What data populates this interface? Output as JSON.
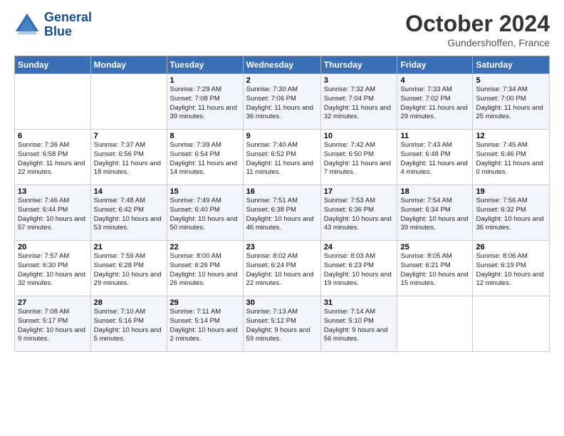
{
  "header": {
    "logo_line1": "General",
    "logo_line2": "Blue",
    "month": "October 2024",
    "location": "Gundershoffen, France"
  },
  "days_of_week": [
    "Sunday",
    "Monday",
    "Tuesday",
    "Wednesday",
    "Thursday",
    "Friday",
    "Saturday"
  ],
  "weeks": [
    [
      {
        "num": "",
        "info": ""
      },
      {
        "num": "",
        "info": ""
      },
      {
        "num": "1",
        "info": "Sunrise: 7:29 AM\nSunset: 7:08 PM\nDaylight: 11 hours and 39 minutes."
      },
      {
        "num": "2",
        "info": "Sunrise: 7:30 AM\nSunset: 7:06 PM\nDaylight: 11 hours and 36 minutes."
      },
      {
        "num": "3",
        "info": "Sunrise: 7:32 AM\nSunset: 7:04 PM\nDaylight: 11 hours and 32 minutes."
      },
      {
        "num": "4",
        "info": "Sunrise: 7:33 AM\nSunset: 7:02 PM\nDaylight: 11 hours and 29 minutes."
      },
      {
        "num": "5",
        "info": "Sunrise: 7:34 AM\nSunset: 7:00 PM\nDaylight: 11 hours and 25 minutes."
      }
    ],
    [
      {
        "num": "6",
        "info": "Sunrise: 7:36 AM\nSunset: 6:58 PM\nDaylight: 11 hours and 22 minutes."
      },
      {
        "num": "7",
        "info": "Sunrise: 7:37 AM\nSunset: 6:56 PM\nDaylight: 11 hours and 18 minutes."
      },
      {
        "num": "8",
        "info": "Sunrise: 7:39 AM\nSunset: 6:54 PM\nDaylight: 11 hours and 14 minutes."
      },
      {
        "num": "9",
        "info": "Sunrise: 7:40 AM\nSunset: 6:52 PM\nDaylight: 11 hours and 11 minutes."
      },
      {
        "num": "10",
        "info": "Sunrise: 7:42 AM\nSunset: 6:50 PM\nDaylight: 11 hours and 7 minutes."
      },
      {
        "num": "11",
        "info": "Sunrise: 7:43 AM\nSunset: 6:48 PM\nDaylight: 11 hours and 4 minutes."
      },
      {
        "num": "12",
        "info": "Sunrise: 7:45 AM\nSunset: 6:46 PM\nDaylight: 11 hours and 0 minutes."
      }
    ],
    [
      {
        "num": "13",
        "info": "Sunrise: 7:46 AM\nSunset: 6:44 PM\nDaylight: 10 hours and 57 minutes."
      },
      {
        "num": "14",
        "info": "Sunrise: 7:48 AM\nSunset: 6:42 PM\nDaylight: 10 hours and 53 minutes."
      },
      {
        "num": "15",
        "info": "Sunrise: 7:49 AM\nSunset: 6:40 PM\nDaylight: 10 hours and 50 minutes."
      },
      {
        "num": "16",
        "info": "Sunrise: 7:51 AM\nSunset: 6:38 PM\nDaylight: 10 hours and 46 minutes."
      },
      {
        "num": "17",
        "info": "Sunrise: 7:53 AM\nSunset: 6:36 PM\nDaylight: 10 hours and 43 minutes."
      },
      {
        "num": "18",
        "info": "Sunrise: 7:54 AM\nSunset: 6:34 PM\nDaylight: 10 hours and 39 minutes."
      },
      {
        "num": "19",
        "info": "Sunrise: 7:56 AM\nSunset: 6:32 PM\nDaylight: 10 hours and 36 minutes."
      }
    ],
    [
      {
        "num": "20",
        "info": "Sunrise: 7:57 AM\nSunset: 6:30 PM\nDaylight: 10 hours and 32 minutes."
      },
      {
        "num": "21",
        "info": "Sunrise: 7:59 AM\nSunset: 6:28 PM\nDaylight: 10 hours and 29 minutes."
      },
      {
        "num": "22",
        "info": "Sunrise: 8:00 AM\nSunset: 6:26 PM\nDaylight: 10 hours and 26 minutes."
      },
      {
        "num": "23",
        "info": "Sunrise: 8:02 AM\nSunset: 6:24 PM\nDaylight: 10 hours and 22 minutes."
      },
      {
        "num": "24",
        "info": "Sunrise: 8:03 AM\nSunset: 6:23 PM\nDaylight: 10 hours and 19 minutes."
      },
      {
        "num": "25",
        "info": "Sunrise: 8:05 AM\nSunset: 6:21 PM\nDaylight: 10 hours and 15 minutes."
      },
      {
        "num": "26",
        "info": "Sunrise: 8:06 AM\nSunset: 6:19 PM\nDaylight: 10 hours and 12 minutes."
      }
    ],
    [
      {
        "num": "27",
        "info": "Sunrise: 7:08 AM\nSunset: 5:17 PM\nDaylight: 10 hours and 9 minutes."
      },
      {
        "num": "28",
        "info": "Sunrise: 7:10 AM\nSunset: 5:16 PM\nDaylight: 10 hours and 5 minutes."
      },
      {
        "num": "29",
        "info": "Sunrise: 7:11 AM\nSunset: 5:14 PM\nDaylight: 10 hours and 2 minutes."
      },
      {
        "num": "30",
        "info": "Sunrise: 7:13 AM\nSunset: 5:12 PM\nDaylight: 9 hours and 59 minutes."
      },
      {
        "num": "31",
        "info": "Sunrise: 7:14 AM\nSunset: 5:10 PM\nDaylight: 9 hours and 56 minutes."
      },
      {
        "num": "",
        "info": ""
      },
      {
        "num": "",
        "info": ""
      }
    ]
  ]
}
